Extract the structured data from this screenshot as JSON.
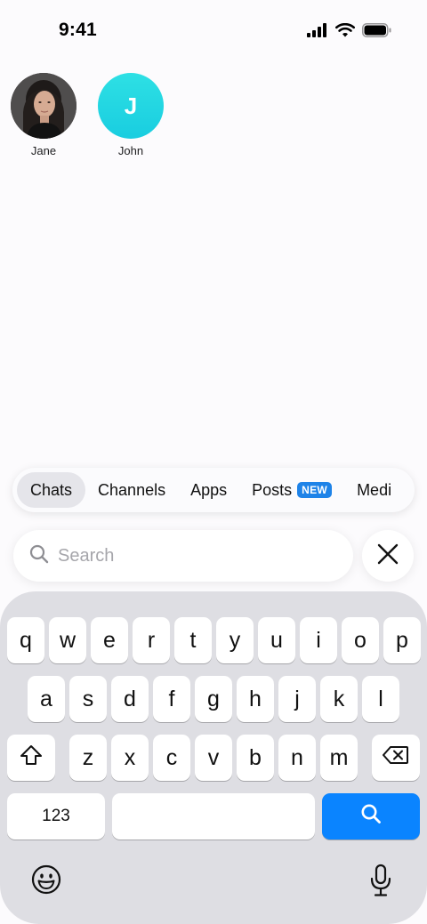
{
  "status_bar": {
    "time": "9:41",
    "icons": [
      "cellular-signal-icon",
      "wifi-icon",
      "battery-icon"
    ]
  },
  "recent_contacts": [
    {
      "name": "Jane",
      "avatar": "photo"
    },
    {
      "name": "John",
      "avatar_initial": "J",
      "avatar_color": "#22d6e2"
    }
  ],
  "tabs": {
    "items": [
      "Chats",
      "Channels",
      "Apps",
      "Posts",
      "Medi"
    ],
    "active": "Chats",
    "posts_badge": "NEW"
  },
  "search": {
    "placeholder": "Search",
    "value": ""
  },
  "keyboard": {
    "row1": [
      "q",
      "w",
      "e",
      "r",
      "t",
      "y",
      "u",
      "i",
      "o",
      "p"
    ],
    "row2": [
      "a",
      "s",
      "d",
      "f",
      "g",
      "h",
      "j",
      "k",
      "l"
    ],
    "row3": [
      "z",
      "x",
      "c",
      "v",
      "b",
      "n",
      "m"
    ],
    "numbers_key": "123",
    "accent_color": "#0a84ff"
  }
}
